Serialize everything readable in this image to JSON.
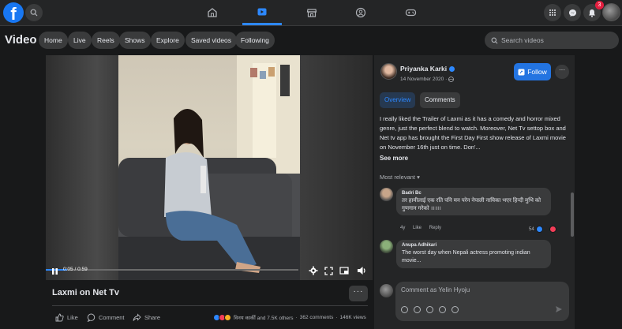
{
  "colors": {
    "accent": "#2d88ff",
    "background": "#18191a",
    "surface": "#242526"
  },
  "nav": {
    "tabs": [
      {
        "name": "home-icon"
      },
      {
        "name": "watch-icon",
        "active": true
      },
      {
        "name": "marketplace-icon"
      },
      {
        "name": "groups-icon"
      },
      {
        "name": "gaming-icon"
      }
    ],
    "notification_count": "3"
  },
  "subnav": {
    "title": "Video",
    "pills": [
      "Home",
      "Live",
      "Reels",
      "Shows",
      "Explore",
      "Saved videos",
      "Following"
    ],
    "search_placeholder": "Search videos"
  },
  "player": {
    "time": "0:05 / 0:59",
    "progress": 0.085
  },
  "video": {
    "title": "Laxmi on Net Tv",
    "more": "···"
  },
  "actions": {
    "like": "Like",
    "comment": "Comment",
    "share": "Share",
    "reactions_text": "विनय कार्की and 7.5K others",
    "comments_count": "362 comments",
    "views": "146K views"
  },
  "author": {
    "name": "Priyanka Karki",
    "date": "14 November 2020 ·",
    "follow": "Follow",
    "more": "···"
  },
  "panel_tabs": [
    "Overview",
    "Comments"
  ],
  "description": "I really liked the Trailer of Laxmi as it has a comedy and horror mixed genre, just the perfect blend to watch. Moreover, Net Tv settop box and Net tv app has brought the First Day First show release of Laxmi movie on November 16th just on time. Don'...",
  "see_more": "See more",
  "sort_label": "Most relevant ▾",
  "comments": [
    {
      "name": "Badri Bc",
      "text": "तर हामीलाई एक रति पनि मन परेन नेपाली नायिका भएर हिन्दी मुभि को गुणगान गरेको ।।।।।",
      "time": "4y",
      "like": "Like",
      "reply": "Reply",
      "reactions": "54"
    },
    {
      "name": "Anupa Adhikari",
      "text": "The worst day when Nepali actress promoting indian movie..."
    }
  ],
  "comment_box": {
    "placeholder": "Comment as Yelin Hyoju"
  }
}
